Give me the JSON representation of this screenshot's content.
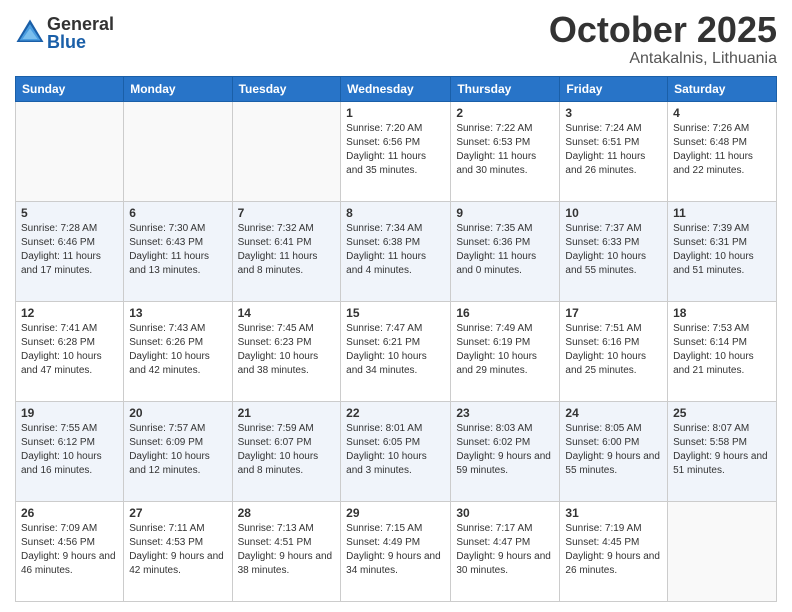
{
  "header": {
    "logo_general": "General",
    "logo_blue": "Blue",
    "month_title": "October 2025",
    "location": "Antakalnis, Lithuania"
  },
  "weekdays": [
    "Sunday",
    "Monday",
    "Tuesday",
    "Wednesday",
    "Thursday",
    "Friday",
    "Saturday"
  ],
  "weeks": [
    [
      {
        "day": "",
        "info": ""
      },
      {
        "day": "",
        "info": ""
      },
      {
        "day": "",
        "info": ""
      },
      {
        "day": "1",
        "info": "Sunrise: 7:20 AM\nSunset: 6:56 PM\nDaylight: 11 hours and 35 minutes."
      },
      {
        "day": "2",
        "info": "Sunrise: 7:22 AM\nSunset: 6:53 PM\nDaylight: 11 hours and 30 minutes."
      },
      {
        "day": "3",
        "info": "Sunrise: 7:24 AM\nSunset: 6:51 PM\nDaylight: 11 hours and 26 minutes."
      },
      {
        "day": "4",
        "info": "Sunrise: 7:26 AM\nSunset: 6:48 PM\nDaylight: 11 hours and 22 minutes."
      }
    ],
    [
      {
        "day": "5",
        "info": "Sunrise: 7:28 AM\nSunset: 6:46 PM\nDaylight: 11 hours and 17 minutes."
      },
      {
        "day": "6",
        "info": "Sunrise: 7:30 AM\nSunset: 6:43 PM\nDaylight: 11 hours and 13 minutes."
      },
      {
        "day": "7",
        "info": "Sunrise: 7:32 AM\nSunset: 6:41 PM\nDaylight: 11 hours and 8 minutes."
      },
      {
        "day": "8",
        "info": "Sunrise: 7:34 AM\nSunset: 6:38 PM\nDaylight: 11 hours and 4 minutes."
      },
      {
        "day": "9",
        "info": "Sunrise: 7:35 AM\nSunset: 6:36 PM\nDaylight: 11 hours and 0 minutes."
      },
      {
        "day": "10",
        "info": "Sunrise: 7:37 AM\nSunset: 6:33 PM\nDaylight: 10 hours and 55 minutes."
      },
      {
        "day": "11",
        "info": "Sunrise: 7:39 AM\nSunset: 6:31 PM\nDaylight: 10 hours and 51 minutes."
      }
    ],
    [
      {
        "day": "12",
        "info": "Sunrise: 7:41 AM\nSunset: 6:28 PM\nDaylight: 10 hours and 47 minutes."
      },
      {
        "day": "13",
        "info": "Sunrise: 7:43 AM\nSunset: 6:26 PM\nDaylight: 10 hours and 42 minutes."
      },
      {
        "day": "14",
        "info": "Sunrise: 7:45 AM\nSunset: 6:23 PM\nDaylight: 10 hours and 38 minutes."
      },
      {
        "day": "15",
        "info": "Sunrise: 7:47 AM\nSunset: 6:21 PM\nDaylight: 10 hours and 34 minutes."
      },
      {
        "day": "16",
        "info": "Sunrise: 7:49 AM\nSunset: 6:19 PM\nDaylight: 10 hours and 29 minutes."
      },
      {
        "day": "17",
        "info": "Sunrise: 7:51 AM\nSunset: 6:16 PM\nDaylight: 10 hours and 25 minutes."
      },
      {
        "day": "18",
        "info": "Sunrise: 7:53 AM\nSunset: 6:14 PM\nDaylight: 10 hours and 21 minutes."
      }
    ],
    [
      {
        "day": "19",
        "info": "Sunrise: 7:55 AM\nSunset: 6:12 PM\nDaylight: 10 hours and 16 minutes."
      },
      {
        "day": "20",
        "info": "Sunrise: 7:57 AM\nSunset: 6:09 PM\nDaylight: 10 hours and 12 minutes."
      },
      {
        "day": "21",
        "info": "Sunrise: 7:59 AM\nSunset: 6:07 PM\nDaylight: 10 hours and 8 minutes."
      },
      {
        "day": "22",
        "info": "Sunrise: 8:01 AM\nSunset: 6:05 PM\nDaylight: 10 hours and 3 minutes."
      },
      {
        "day": "23",
        "info": "Sunrise: 8:03 AM\nSunset: 6:02 PM\nDaylight: 9 hours and 59 minutes."
      },
      {
        "day": "24",
        "info": "Sunrise: 8:05 AM\nSunset: 6:00 PM\nDaylight: 9 hours and 55 minutes."
      },
      {
        "day": "25",
        "info": "Sunrise: 8:07 AM\nSunset: 5:58 PM\nDaylight: 9 hours and 51 minutes."
      }
    ],
    [
      {
        "day": "26",
        "info": "Sunrise: 7:09 AM\nSunset: 4:56 PM\nDaylight: 9 hours and 46 minutes."
      },
      {
        "day": "27",
        "info": "Sunrise: 7:11 AM\nSunset: 4:53 PM\nDaylight: 9 hours and 42 minutes."
      },
      {
        "day": "28",
        "info": "Sunrise: 7:13 AM\nSunset: 4:51 PM\nDaylight: 9 hours and 38 minutes."
      },
      {
        "day": "29",
        "info": "Sunrise: 7:15 AM\nSunset: 4:49 PM\nDaylight: 9 hours and 34 minutes."
      },
      {
        "day": "30",
        "info": "Sunrise: 7:17 AM\nSunset: 4:47 PM\nDaylight: 9 hours and 30 minutes."
      },
      {
        "day": "31",
        "info": "Sunrise: 7:19 AM\nSunset: 4:45 PM\nDaylight: 9 hours and 26 minutes."
      },
      {
        "day": "",
        "info": ""
      }
    ]
  ]
}
